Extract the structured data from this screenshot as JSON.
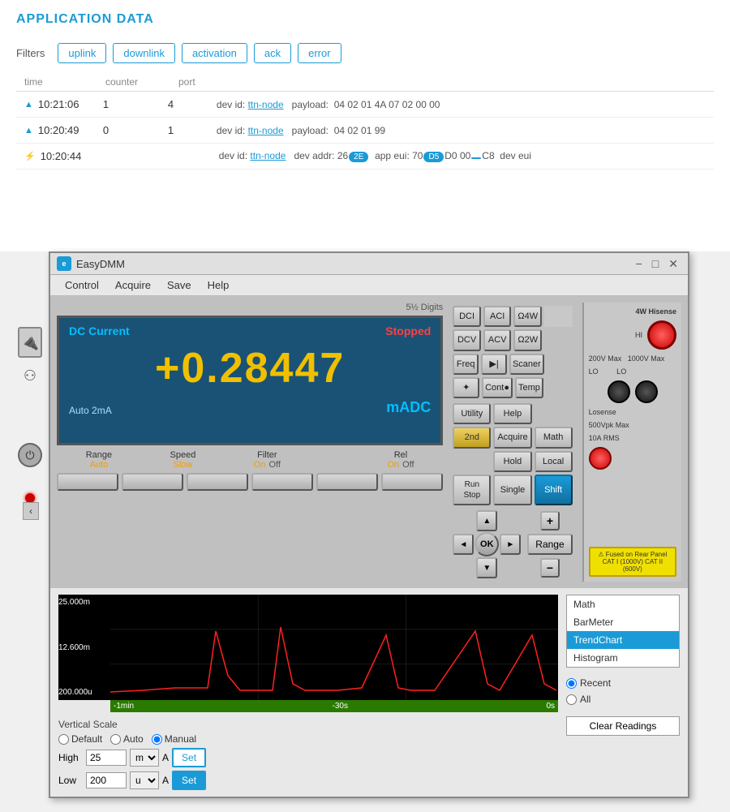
{
  "app": {
    "title": "APPLICATION DATA"
  },
  "filters": {
    "label": "Filters",
    "buttons": [
      "uplink",
      "downlink",
      "activation",
      "ack",
      "error"
    ]
  },
  "table": {
    "headers": [
      "time",
      "counter",
      "port"
    ],
    "rows": [
      {
        "type": "uplink",
        "time": "10:21:06",
        "counter": "1",
        "port": "4",
        "dev_id_label": "dev id:",
        "dev_id_link": "ttn-node",
        "payload_label": "payload:",
        "payload": "04 02 01 4A 07 02 00 00"
      },
      {
        "type": "uplink",
        "time": "10:20:49",
        "counter": "0",
        "port": "1",
        "dev_id_label": "dev id:",
        "dev_id_link": "ttn-node",
        "payload_label": "payload:",
        "payload": "04 02 01 99"
      },
      {
        "type": "activation",
        "time": "10:20:44",
        "dev_id_label": "dev id:",
        "dev_id_link": "ttn-node",
        "dev_addr_label": "dev addr:",
        "dev_addr": "26",
        "app_eui_label": "app eui:",
        "app_eui": "70",
        "dev_eui_label": "dev eui"
      }
    ]
  },
  "dmm": {
    "title": "EasyDMM",
    "digits_label": "5½ Digits",
    "menu": [
      "Control",
      "Acquire",
      "Save",
      "Help"
    ],
    "display": {
      "mode": "DC Current",
      "status": "Stopped",
      "value": "+0.28447",
      "range_text": "Auto 2mA",
      "unit": "mADC"
    },
    "soft_buttons": {
      "range": {
        "label": "Range",
        "value": "Auto"
      },
      "speed": {
        "label": "Speed",
        "value": "Slow"
      },
      "filter": {
        "label": "Filter",
        "on": "On",
        "off": "Off"
      },
      "rel": {
        "label": "Rel",
        "on": "On",
        "off": "Off"
      }
    },
    "function_buttons": [
      {
        "label": "DCI",
        "sub": ""
      },
      {
        "label": "ACI",
        "sub": ""
      },
      {
        "label": "Ω4W",
        "sub": ""
      },
      {
        "label": "DCV",
        "sub": ""
      },
      {
        "label": "ACV",
        "sub": ""
      },
      {
        "label": "Ω2W",
        "sub": ""
      },
      {
        "label": "Freq",
        "sub": ""
      },
      {
        "label": "▶|",
        "sub": ""
      },
      {
        "label": "Scaner",
        "sub": ""
      },
      {
        "label": "✦",
        "sub": ""
      },
      {
        "label": "Cont●",
        "sub": ""
      },
      {
        "label": "Temp",
        "sub": ""
      }
    ],
    "utility_buttons": [
      {
        "label": "Utility",
        "sub": ""
      },
      {
        "label": "Help",
        "sub": ""
      },
      {
        "label": "",
        "sub": ""
      },
      {
        "label": "2nd",
        "sub": ""
      },
      {
        "label": "Acquire",
        "sub": ""
      },
      {
        "label": "Math",
        "sub": ""
      },
      {
        "label": "",
        "sub": ""
      },
      {
        "label": "Hold",
        "sub": ""
      },
      {
        "label": "Local",
        "sub": ""
      },
      {
        "label": "Run Stop",
        "sub": ""
      },
      {
        "label": "Single",
        "sub": ""
      },
      {
        "label": "Shift",
        "sub": ""
      }
    ],
    "nav": {
      "ok_label": "OK",
      "range_label": "Range",
      "up": "▲",
      "down": "▼",
      "left": "◄",
      "right": "►",
      "plus": "+",
      "minus": "−"
    },
    "terminals": {
      "hi_label": "HI",
      "lo_label": "LO",
      "losense_label": "Losense",
      "hisense_label": "4W Hisense",
      "voltage_200v": "200V Max",
      "voltage_1000v": "1000V Max",
      "voltage_500vpk": "500Vpk Max",
      "current_10a": "10A RMS",
      "warning_text": "Fused on Rear Panel CAT I (1000V) CAT II (600V)"
    }
  },
  "chart": {
    "y_labels": [
      "25.000m",
      "12.600m",
      "200.000u"
    ],
    "x_labels": [
      "-1min",
      "-30s",
      "0s"
    ],
    "grid_color": "#2a7a00"
  },
  "scale": {
    "title": "Vertical Scale",
    "options": [
      "Default",
      "Auto",
      "Manual"
    ],
    "selected": "Manual",
    "time_options": [
      "Recent",
      "All"
    ],
    "selected_time": "Recent",
    "high_label": "High",
    "high_value": "25",
    "high_unit": "m",
    "high_unit2": "A",
    "low_label": "Low",
    "low_value": "200",
    "low_unit": "u",
    "low_unit2": "A",
    "set_label": "Set",
    "clear_label": "Clear Readings"
  },
  "list_panel": {
    "items": [
      "Math",
      "BarMeter",
      "TrendChart",
      "Histogram"
    ],
    "selected": "TrendChart"
  }
}
